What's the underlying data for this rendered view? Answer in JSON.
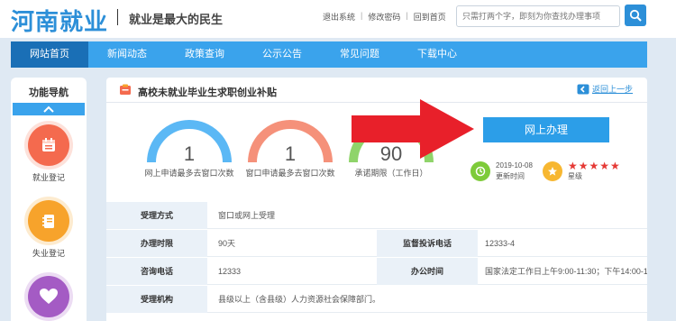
{
  "header": {
    "logo": "河南就业",
    "slogan": "就业是最大的民生",
    "links": [
      "退出系统",
      "修改密码",
      "回到首页"
    ],
    "search_placeholder": "只需打两个字，即刻为你查找办理事项"
  },
  "nav": {
    "items": [
      "网站首页",
      "新闻动态",
      "政策查询",
      "公示公告",
      "常见问题",
      "下载中心"
    ]
  },
  "sidebar": {
    "title": "功能导航",
    "items": [
      {
        "label": "就业登记",
        "icon": "calendar-icon",
        "color": "#f46a4e"
      },
      {
        "label": "失业登记",
        "icon": "notebook-icon",
        "color": "#f7a32b"
      },
      {
        "label": "",
        "icon": "heart-icon",
        "color": "#a45bc4"
      }
    ]
  },
  "panel": {
    "title": "高校未就业毕业生求职创业补贴",
    "back": "返回上一步",
    "gauges": [
      {
        "value": "1",
        "label": "网上申请最多去窗口次数",
        "color": "#5bb8f5"
      },
      {
        "value": "1",
        "label": "窗口申请最多去窗口次数",
        "color": "#f5917a"
      },
      {
        "value": "90",
        "label": "承诺期限（工作日）",
        "color": "#8fd46a"
      }
    ],
    "apply_button": "网上办理",
    "updated": {
      "date": "2019-10-08",
      "label": "更新时间"
    },
    "rating": {
      "stars": "★★★★★",
      "label": "星级"
    }
  },
  "table": {
    "rows": [
      [
        {
          "k": "受理方式",
          "v": "窗口或网上受理"
        }
      ],
      [
        {
          "k": "办理时限",
          "v": "90天"
        },
        {
          "k": "监督投诉电话",
          "v": "12333-4"
        }
      ],
      [
        {
          "k": "咨询电话",
          "v": "12333"
        },
        {
          "k": "办公时间",
          "v": "国家法定工作日上午9:00-11:30；下午14:00-17:00"
        }
      ],
      [
        {
          "k": "受理机构",
          "v": "县级以上（含县级）人力资源社会保障部门。"
        }
      ]
    ]
  }
}
